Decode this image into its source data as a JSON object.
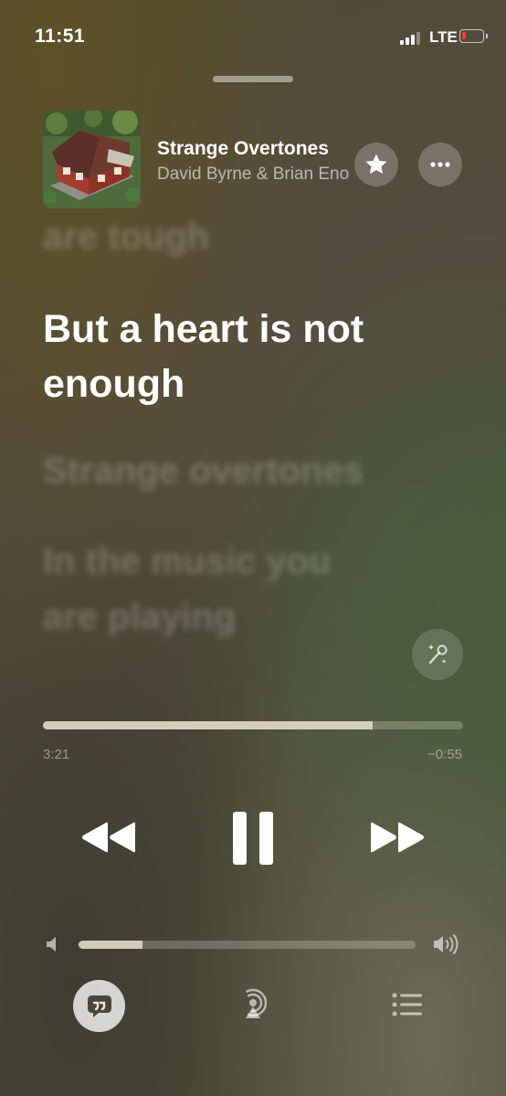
{
  "status_bar": {
    "time": "11:51",
    "network": "LTE",
    "signal_bars": 3,
    "battery_level": 0.1
  },
  "now_playing": {
    "title": "Strange Overtones",
    "artist": "David Byrne & Brian Eno",
    "artwork": "house-artwork"
  },
  "lyrics": {
    "previous": "are tough",
    "current": "But a heart is not enough",
    "next": [
      "Strange overtones",
      "In the music you",
      "are playing"
    ]
  },
  "playback": {
    "elapsed": "3:21",
    "remaining": "−0:55",
    "progress_fraction": 0.785,
    "state": "playing"
  },
  "volume": {
    "level_fraction": 0.19
  },
  "icons": {
    "favorite": "star-icon",
    "more": "ellipsis-icon",
    "sing": "microphone-sparkle-icon",
    "rewind": "backward-icon",
    "pause": "pause-icon",
    "forward": "forward-icon",
    "volume_low": "speaker-low-icon",
    "volume_high": "speaker-high-icon",
    "lyrics": "quote-bubble-icon",
    "airplay": "airplay-audio-icon",
    "queue": "list-icon"
  },
  "colors": {
    "accent_fill": "#ece8d2",
    "battery_low": "#ff3b30"
  }
}
